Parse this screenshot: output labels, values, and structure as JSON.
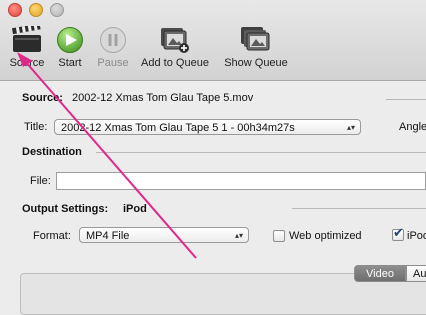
{
  "toolbar": {
    "source_label": "Source",
    "start_label": "Start",
    "pause_label": "Pause",
    "add_queue_label": "Add to Queue",
    "show_queue_label": "Show Queue"
  },
  "source": {
    "label": "Source:",
    "value": "2002-12 Xmas Tom Glau Tape 5.mov"
  },
  "title": {
    "label": "Title:",
    "value": "2002-12 Xmas Tom Glau Tape 5 1 - 00h34m27s",
    "angle_label": "Angle"
  },
  "destination": {
    "heading": "Destination",
    "file_label": "File:",
    "file_value": ""
  },
  "output": {
    "heading": "Output Settings:",
    "preset": "iPod",
    "format_label": "Format:",
    "format_value": "MP4 File",
    "web_optimized_label": "Web optimized",
    "web_optimized_checked": false,
    "ipod_label": "iPod",
    "ipod_checked": true
  },
  "tabs": {
    "video": "Video",
    "next": "Au"
  },
  "colors": {
    "annotation_arrow": "#e0288a",
    "start_green": "#5fb335"
  }
}
